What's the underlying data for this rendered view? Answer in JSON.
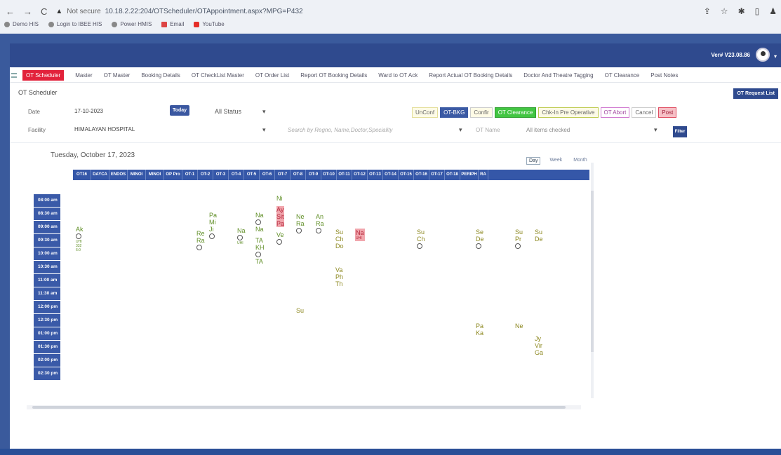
{
  "browser": {
    "back": "←",
    "fwd": "→",
    "reload": "C",
    "warn_icon": "▲",
    "warn": "Not secure",
    "url": "10.18.2.22:204/OTScheduler/OTAppointment.aspx?MPG=P432",
    "bookmarks": [
      "Demo HIS",
      "Login to IBEE HIS",
      "Power HMIS",
      "Email",
      "YouTube"
    ],
    "icons": [
      "share-icon",
      "star-icon",
      "extensions-icon",
      "sidebar-icon",
      "profile-icon",
      "menu-icon"
    ]
  },
  "topbar": {
    "version": "Ver# V23.08.86"
  },
  "nav": {
    "tabs": [
      "OT Scheduler",
      "Master",
      "OT Master",
      "Booking Details",
      "OT CheckList Master",
      "OT Order List",
      "Report OT Booking Details",
      "Ward to OT Ack",
      "Report Actual OT Booking Details",
      "Doctor And Theatre Tagging",
      "OT Clearance",
      "Post Notes"
    ]
  },
  "page": {
    "title": "OT Scheduler",
    "request_button": "OT Request List",
    "date_label": "Date",
    "date_value": "17-10-2023",
    "today_button": "Today",
    "status_dropdown": "All Status",
    "facility_label": "Facility",
    "facility_value": "HIMALAYAN HOSPITAL",
    "search_placeholder": "Search by Regno, Name,Doctor,Speciality",
    "ot_name_label": "OT Name",
    "ot_name_value": "All items checked",
    "filter_button": "Filter",
    "statuses": [
      "UnConf",
      "OT-BKG",
      "Confir",
      "OT Clearance",
      "Chk-In Pre Operative",
      "OT Abort",
      "Cancel",
      "Post"
    ],
    "date_header": "Tuesday, October 17, 2023",
    "views": [
      "Day",
      "Week",
      "Month"
    ]
  },
  "theatres": [
    "OT16",
    "DAYCA",
    "ENDOS",
    "MINOI",
    "MINOI",
    "OP Pro",
    "OT-1",
    "OT-2",
    "OT-3",
    "OT-4",
    "OT-5",
    "OT-6",
    "OT-7",
    "OT-8",
    "OT-9",
    "OT-10",
    "OT-11",
    "OT-12",
    "OT-13",
    "OT-14",
    "OT-15",
    "OT-16",
    "OT-17",
    "OT-18",
    "PERIPH",
    "RA"
  ],
  "times": [
    "08:00 am",
    "08:30 am",
    "09:00 am",
    "09:30 am",
    "10:00 am",
    "10:30 am",
    "11:00 am",
    "11:30 am",
    "12:00 pm",
    "12:30 pm",
    "01:00 pm",
    "01:30 pm",
    "02:00 pm",
    "02:30 pm"
  ],
  "bookings": [
    {
      "a": "Ak",
      "b": "UHI",
      "c": "332",
      "d": "6:0"
    },
    {
      "a": "Re",
      "b": "Ra"
    },
    {
      "a": "Pa",
      "b": "Mi",
      "c": "Ji"
    },
    {
      "a": "Na",
      "b": "UHI"
    },
    {
      "a": "Na",
      "b": "Na",
      "c": "TA",
      "d": "KH",
      "e": "TA"
    },
    {
      "a": "Ni",
      "b": "Ay",
      "c": "Sit",
      "d": "Pa",
      "e": "Ve"
    },
    {
      "a": "Ne",
      "b": "Ra",
      "c": "Su"
    },
    {
      "a": "An",
      "b": "Ra"
    },
    {
      "a": "Su",
      "b": "Ch",
      "c": "Do",
      "d": "Va",
      "e": "Ph",
      "f": "Th"
    },
    {
      "a": "Na",
      "b": "UHI"
    },
    {
      "a": "Su",
      "b": "Ch"
    },
    {
      "a": "Se",
      "b": "De",
      "c": "Pa",
      "d": "Ka"
    },
    {
      "a": "Su",
      "b": "Pr",
      "c": "Ne"
    },
    {
      "a": "Su",
      "b": "De",
      "c": "Jy",
      "d": "Vir",
      "e": "Ga"
    }
  ]
}
